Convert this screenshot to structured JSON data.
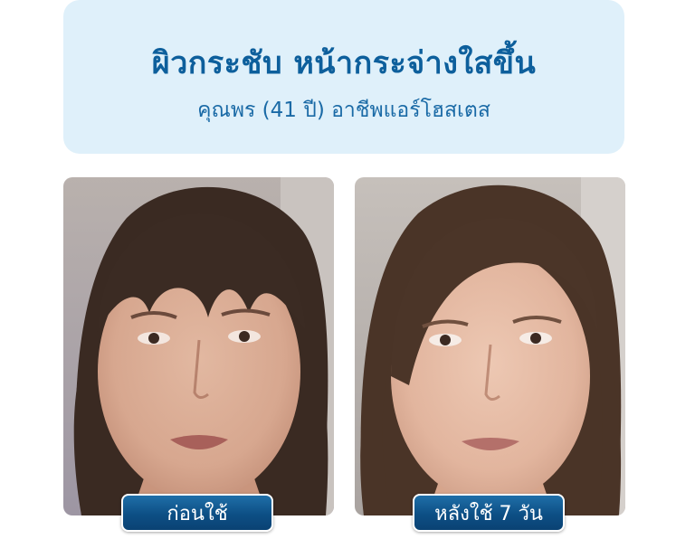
{
  "header": {
    "title": "ผิวกระชับ หน้ากระจ่างใสขึ้น",
    "subtitle": "คุณพร (41 ปี) อาชีพแอร์โฮสเตส"
  },
  "photos": {
    "before": {
      "label": "ก่อนใช้",
      "image": "face-before-photo"
    },
    "after": {
      "label": "หลังใช้ 7 วัน",
      "image": "face-after-photo"
    }
  },
  "colors": {
    "header_bg": "#dff0fa",
    "title": "#0d5f9c",
    "badge": "#0d4f85"
  }
}
